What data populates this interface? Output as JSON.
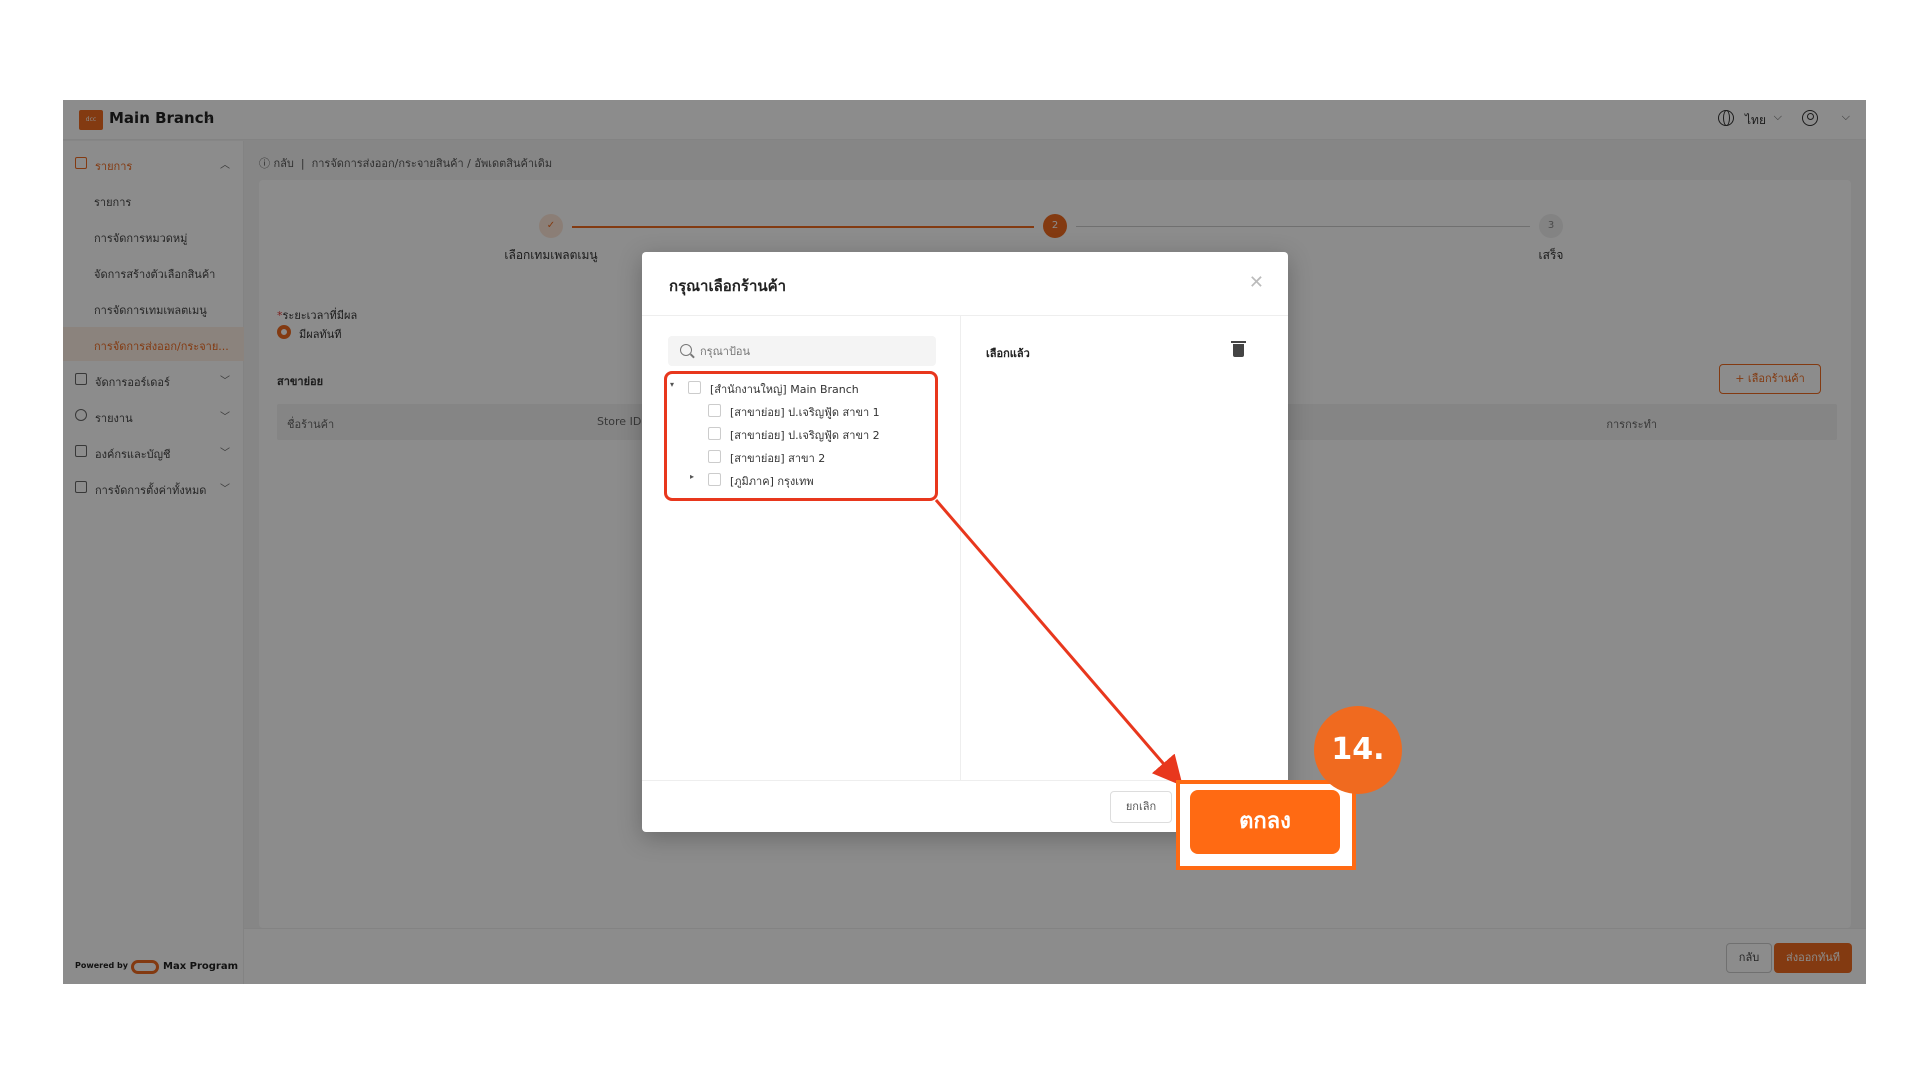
{
  "topbar": {
    "logo_text": "dcc",
    "branch_title": "Main Branch",
    "language": "ไทย"
  },
  "sidebar": {
    "items": [
      {
        "label": "รายการ",
        "type": "parent-open"
      },
      {
        "label": "รายการ",
        "type": "sub"
      },
      {
        "label": "การจัดการหมวดหมู่",
        "type": "sub"
      },
      {
        "label": "จัดการสร้างตัวเลือกสินค้า",
        "type": "sub"
      },
      {
        "label": "การจัดการเทมเพลตเมนู",
        "type": "sub"
      },
      {
        "label": "การจัดการส่งออก/กระจาย...",
        "type": "sub-active"
      },
      {
        "label": "จัดการออร์เดอร์",
        "type": "parent"
      },
      {
        "label": "รายงาน",
        "type": "parent"
      },
      {
        "label": "องค์กรและบัญชี",
        "type": "parent"
      },
      {
        "label": "การจัดการตั้งค่าทั้งหมด",
        "type": "parent"
      }
    ],
    "powered_by": "Powered by",
    "powered_name": "Max Program"
  },
  "breadcrumb": {
    "back": "กลับ",
    "path": "การจัดการส่งออก/กระจายสินค้า / อัพเดตสินค้าเดิม"
  },
  "steps": [
    {
      "number": "✓",
      "label": "เลือกเทมเพลตเมนู"
    },
    {
      "number": "2",
      "label": ""
    },
    {
      "number": "3",
      "label": "เสร็จ"
    }
  ],
  "form": {
    "period_label": "ระยะเวลาที่มีผล",
    "radio_now": "มีผลทันที",
    "branches_label": "สาขาย่อย",
    "select_store_button": "+ เลือกร้านค้า",
    "table_headers": {
      "name": "ชื่อร้านค้า",
      "store_id": "Store ID",
      "action": "การกระทำ"
    }
  },
  "footer": {
    "back_button": "กลับ",
    "export_button": "ส่งออกทันที"
  },
  "modal": {
    "title": "กรุณาเลือกร้านค้า",
    "search_placeholder": "กรุณาป้อน",
    "tree": [
      {
        "label": "[สำนักงานใหญ่] Main Branch",
        "level": 0,
        "caret": "▾"
      },
      {
        "label": "[สาขาย่อย] ป.เจริญฟู้ด สาขา 1",
        "level": 1,
        "caret": ""
      },
      {
        "label": "[สาขาย่อย] ป.เจริญฟู้ด สาขา 2",
        "level": 1,
        "caret": ""
      },
      {
        "label": "[สาขาย่อย] สาขา 2",
        "level": 1,
        "caret": ""
      },
      {
        "label": "[ภูมิภาค] กรุงเทพ",
        "level": 1,
        "caret": "▸"
      }
    ],
    "selected_label": "เลือกแล้ว",
    "cancel_button": "ยกเลิก",
    "ok_button": "ตกลง"
  },
  "annotation": {
    "step_number": "14.",
    "colors": {
      "accent": "#ee6a1f",
      "highlight": "#e8371d"
    }
  }
}
